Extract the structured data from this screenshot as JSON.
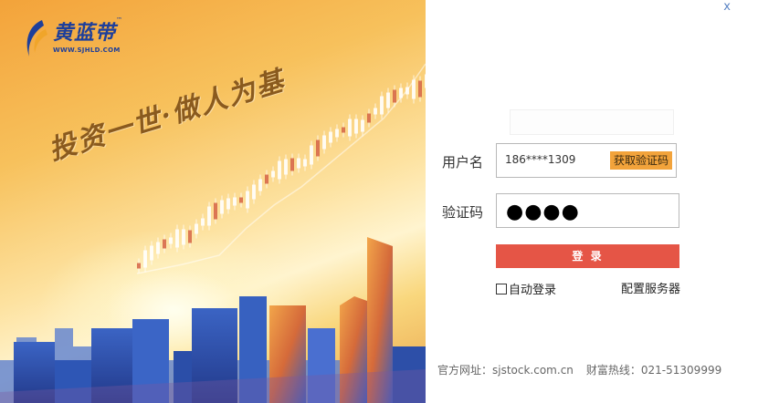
{
  "brand": {
    "name": "黄蓝带",
    "tm": "™",
    "url": "WWW.SJHLD.COM",
    "slogan": "投资一世·做人为基"
  },
  "window": {
    "close": "x"
  },
  "form": {
    "username_label": "用户名",
    "username_value": "186****1309",
    "get_code_label": "获取验证码",
    "code_label": "验证码",
    "code_value": "●●●●",
    "login_label": "登 录",
    "remember_label": "自动登录",
    "server_label": "配置服务器"
  },
  "footer": {
    "site": "官方网址：sjstock.com.cn",
    "hotline": "财富热线：021-51309999"
  },
  "colors": {
    "login_button": "#e55546",
    "code_button": "#f2a33b",
    "brand_blue": "#1e3f9a"
  }
}
